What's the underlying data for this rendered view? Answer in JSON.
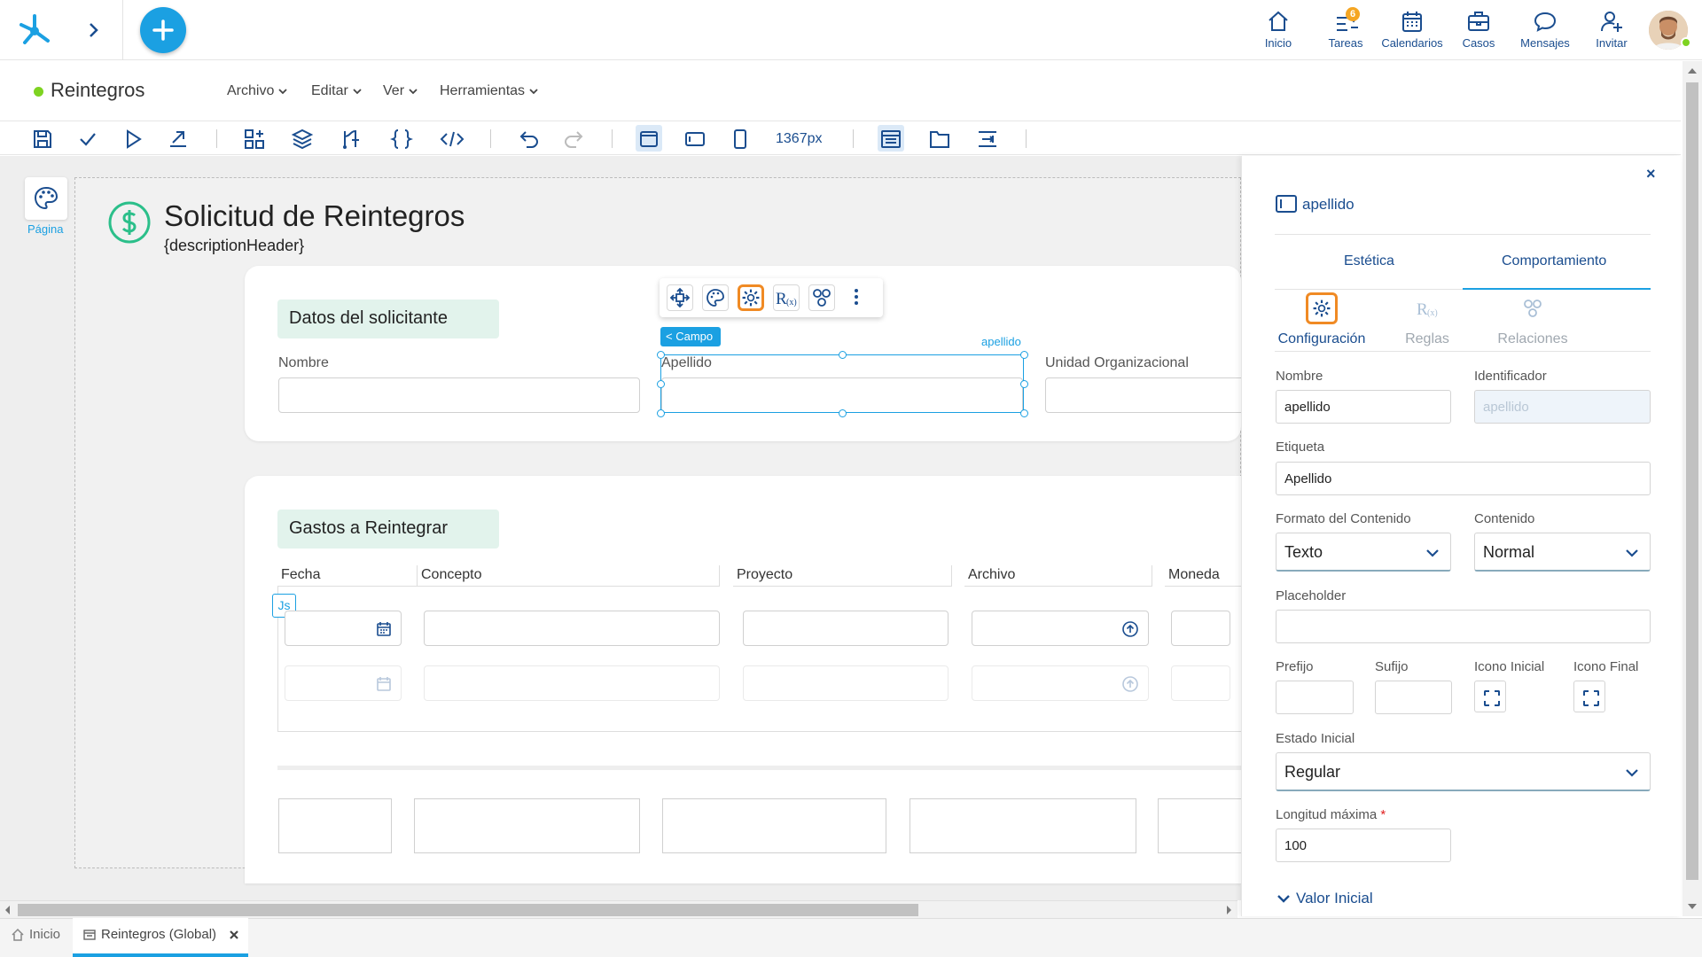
{
  "header": {
    "nav": [
      {
        "label": "Inicio",
        "icon": "home-icon"
      },
      {
        "label": "Tareas",
        "icon": "tasks-icon",
        "badge": "6"
      },
      {
        "label": "Calendarios",
        "icon": "calendar-icon"
      },
      {
        "label": "Casos",
        "icon": "briefcase-icon"
      },
      {
        "label": "Mensajes",
        "icon": "chat-icon"
      },
      {
        "label": "Invitar",
        "icon": "invite-user-icon"
      }
    ]
  },
  "titlebar": {
    "title": "Reintegros",
    "status_color": "#7ed321",
    "menus": [
      "Archivo",
      "Editar",
      "Ver",
      "Herramientas"
    ]
  },
  "toolbar": {
    "width_label": "1367px"
  },
  "left_tool": {
    "label": "Página"
  },
  "form": {
    "title": "Solicitud de Reintegros",
    "subtitle": "{descriptionHeader}",
    "section1": {
      "label": "Datos del solicitante",
      "fields": [
        "Nombre",
        "Apellido",
        "Unidad Organizacional"
      ]
    },
    "section2": {
      "label": "Gastos a Reintegrar",
      "columns": [
        "Fecha",
        "Concepto",
        "Proyecto",
        "Archivo",
        "Moneda"
      ]
    },
    "selected_tag": "< Campo",
    "selected_id": "apellido",
    "js_tag": "Js"
  },
  "panel": {
    "close": "×",
    "title": "apellido",
    "tabs": [
      "Estética",
      "Comportamiento"
    ],
    "subtabs": [
      "Configuración",
      "Reglas",
      "Relaciones"
    ],
    "labels": {
      "nombre": "Nombre",
      "identificador": "Identificador",
      "etiqueta": "Etiqueta",
      "formato": "Formato del Contenido",
      "contenido": "Contenido",
      "placeholder": "Placeholder",
      "prefijo": "Prefijo",
      "sufijo": "Sufijo",
      "icono_inicial": "Icono Inicial",
      "icono_final": "Icono Final",
      "estado": "Estado Inicial",
      "longitud": "Longitud máxima",
      "valor_inicial": "Valor Inicial"
    },
    "values": {
      "nombre": "apellido",
      "identificador": "apellido",
      "etiqueta": "Apellido",
      "formato": "Texto",
      "contenido": "Normal",
      "placeholder": "",
      "prefijo": "",
      "sufijo": "",
      "estado": "Regular",
      "longitud": "100"
    },
    "required_mark": "*"
  },
  "bottom_tabs": [
    {
      "label": "Inicio"
    },
    {
      "label": "Reintegros (Global)"
    }
  ],
  "colors": {
    "accent": "#1ba0e2",
    "primary_text": "#1a4d8f",
    "section_bg": "#e2f3ec",
    "highlight": "#f08a24"
  }
}
